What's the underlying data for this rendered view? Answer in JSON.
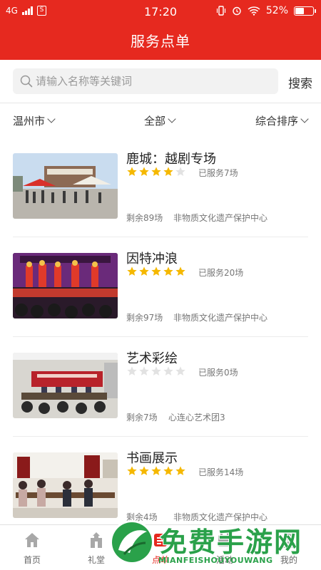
{
  "status_bar": {
    "network": "4G",
    "sim_label": "S",
    "time": "17:20",
    "battery_percent": "52%",
    "battery_level": 0.52
  },
  "app_bar": {
    "title": "服务点单"
  },
  "search": {
    "placeholder": "请输入名称等关键词",
    "value": "",
    "button_label": "搜索"
  },
  "filters": {
    "city": "温州市",
    "category": "全部",
    "sort": "综合排序"
  },
  "items": [
    {
      "title": "鹿城：越剧专场",
      "rating": 4,
      "served": "已服务7场",
      "remaining": "剩余89场",
      "organization": "非物质文化遗产保护中心"
    },
    {
      "title": "因特冲浪",
      "rating": 5,
      "served": "已服务20场",
      "remaining": "剩余97场",
      "organization": "非物质文化遗产保护中心"
    },
    {
      "title": "艺术彩绘",
      "rating": 0,
      "served": "已服务0场",
      "remaining": "剩余7场",
      "organization": "心连心艺术团3"
    },
    {
      "title": "书画展示",
      "rating": 5,
      "served": "已服务14场",
      "remaining": "剩余4场",
      "organization": "非物质文化遗产保护中心"
    }
  ],
  "tab_bar": {
    "tabs": [
      {
        "label": "首页",
        "icon": "home-icon"
      },
      {
        "label": "礼堂",
        "icon": "hall-icon"
      },
      {
        "label": "点单",
        "icon": "order-icon"
      },
      {
        "label": "活动",
        "icon": "activity-icon"
      },
      {
        "label": "我的",
        "icon": "user-icon"
      }
    ],
    "active": "点单"
  },
  "watermark": {
    "text": "免费手游网",
    "subtext": "MIANFEISHOUYOUWANG"
  },
  "colors": {
    "brand": "#e6291f",
    "star_on": "#f5b800",
    "star_off": "#e2e2e2",
    "watermark": "#2aa14a"
  }
}
